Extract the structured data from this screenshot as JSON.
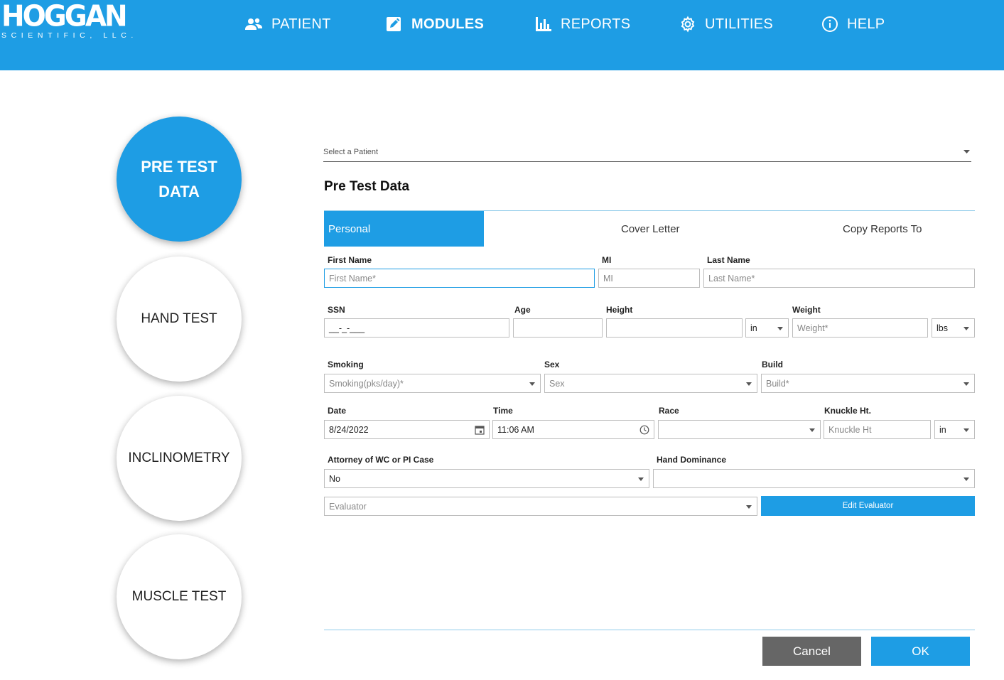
{
  "logo": {
    "main": "HOGGAN",
    "sub": "SCIENTIFIC, LLC."
  },
  "nav": [
    {
      "label": "PATIENT",
      "icon": "patients-icon"
    },
    {
      "label": "MODULES",
      "icon": "edit-icon",
      "active": true
    },
    {
      "label": "REPORTS",
      "icon": "bar-chart-icon"
    },
    {
      "label": "UTILITIES",
      "icon": "gear-icon"
    },
    {
      "label": "HELP",
      "icon": "info-icon"
    }
  ],
  "steps": [
    {
      "line1": "PRE TEST",
      "line2": "DATA",
      "active": true
    },
    {
      "label": "HAND TEST"
    },
    {
      "label": "INCLINOMETRY"
    },
    {
      "label": "MUSCLE TEST"
    }
  ],
  "patient_select": {
    "placeholder": "Select a Patient"
  },
  "section_title": "Pre Test Data",
  "tabs": [
    "Personal",
    "Cover Letter",
    "Copy Reports To"
  ],
  "form": {
    "first_name": {
      "label": "First Name",
      "placeholder": "First Name*"
    },
    "mi": {
      "label": "MI",
      "placeholder": "MI"
    },
    "last_name": {
      "label": "Last Name",
      "placeholder": "Last Name*"
    },
    "ssn": {
      "label": "SSN",
      "value": "__-_-___"
    },
    "age": {
      "label": "Age",
      "value": ""
    },
    "height": {
      "label": "Height",
      "value": "",
      "unit": "in"
    },
    "weight": {
      "label": "Weight",
      "placeholder": "Weight*",
      "unit": "lbs"
    },
    "smoking": {
      "label": "Smoking",
      "placeholder": "Smoking(pks/day)*"
    },
    "sex": {
      "label": "Sex",
      "placeholder": "Sex"
    },
    "build": {
      "label": "Build",
      "placeholder": "Build*"
    },
    "date": {
      "label": "Date",
      "value": "8/24/2022"
    },
    "time": {
      "label": "Time",
      "value": "11:06 AM"
    },
    "race": {
      "label": "Race",
      "value": ""
    },
    "knuckle": {
      "label": "Knuckle Ht.",
      "placeholder": "Knuckle Ht",
      "unit": "in"
    },
    "attorney": {
      "label": "Attorney of WC or PI Case",
      "value": "No"
    },
    "hand_dominance": {
      "label": "Hand Dominance",
      "value": ""
    },
    "evaluator": {
      "placeholder": "Evaluator"
    },
    "edit_evaluator_label": "Edit Evaluator"
  },
  "buttons": {
    "cancel": "Cancel",
    "ok": "OK"
  },
  "colors": {
    "accent": "#1e9de4",
    "cancel_bg": "#666666"
  }
}
